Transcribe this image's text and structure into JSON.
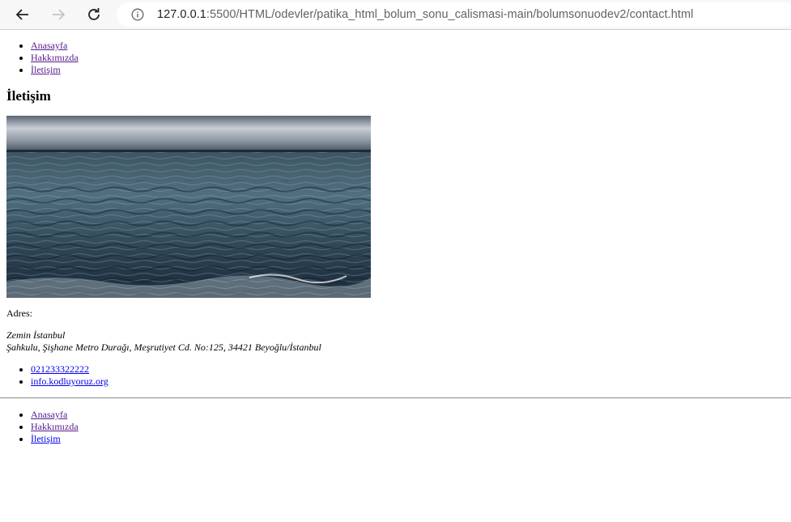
{
  "browser": {
    "url_host": "127.0.0.1",
    "url_path": ":5500/HTML/odevler/patika_html_bolum_sonu_calismasi-main/bolumsonuodev2/contact.html",
    "icons": [
      "back-arrow-icon",
      "forward-arrow-icon",
      "reload-icon",
      "info-icon"
    ]
  },
  "nav": {
    "items": [
      {
        "label": "Anasayfa"
      },
      {
        "label": "Hakkımızda"
      },
      {
        "label": "İletişim"
      }
    ]
  },
  "main": {
    "heading": "İletişim",
    "address_label": "Adres:",
    "address_line1": "Zemin İstanbul",
    "address_line2": "Şahkulu, Şişhane Metro Durağı, Meşrutiyet Cd. No:125, 34421 Beyoğlu/İstanbul",
    "contacts": [
      {
        "label": "021233322222"
      },
      {
        "label": "info.kodluyoruz.org"
      }
    ]
  },
  "footer_nav": {
    "items": [
      {
        "label": "Anasayfa"
      },
      {
        "label": "Hakkımızda"
      },
      {
        "label": "İletişim"
      }
    ]
  },
  "colors": {
    "link": "#0000ee",
    "visited_link": "#551a8b"
  }
}
